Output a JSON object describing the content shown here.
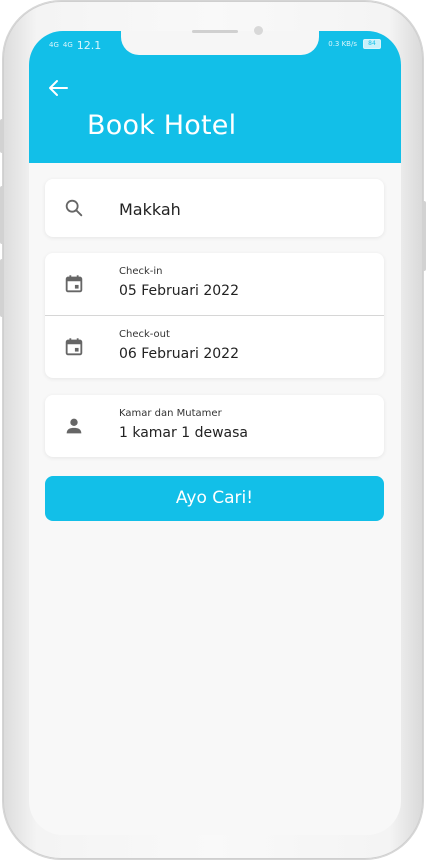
{
  "status_bar": {
    "left_signal_1": "4G",
    "left_signal_2": "4G",
    "time": "12.1",
    "right_speed": "0.3 KB/s",
    "battery": "84"
  },
  "header": {
    "title": "Book Hotel",
    "back_icon": "arrow-left-icon",
    "background_color": "#12BFE8"
  },
  "search": {
    "icon": "search-icon",
    "value": "Makkah"
  },
  "dates": {
    "checkin": {
      "icon": "calendar-icon",
      "label": "Check-in",
      "value": "05 Februari 2022"
    },
    "checkout": {
      "icon": "calendar-icon",
      "label": "Check-out",
      "value": "06 Februari 2022"
    }
  },
  "guests": {
    "icon": "person-icon",
    "label": "Kamar dan Mutamer",
    "value": "1 kamar 1 dewasa"
  },
  "actions": {
    "search_button_label": "Ayo Cari!",
    "accent_color": "#12BFE8"
  }
}
